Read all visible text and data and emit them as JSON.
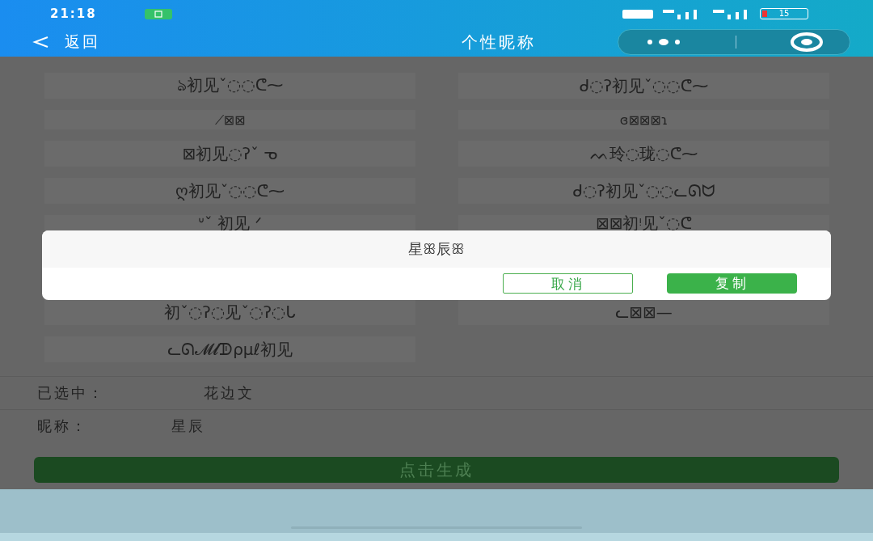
{
  "status_bar": {
    "time": "21:18",
    "battery": "15"
  },
  "nav": {
    "back": "返回",
    "title": "个性昵称"
  },
  "names": [
    {
      "left": "ঌ初见ˇ◌◌ᕦ⁓",
      "right": "ᑯ◌ʔ初见ˇ◌◌ᕦ⁓"
    },
    {
      "left": "⟋⊠⊠",
      "right": "ɞ⊠⊠⊠ɿ"
    },
    {
      "left": "⊠初见◌ʔˇ ᓀ",
      "right": "ᨓ玲◌珑◌ᕦ⁓"
    },
    {
      "left": "ღ初见ˇ◌◌ᕦ⁓",
      "right": "ᑯ◌ʔ初见ˇ◌◌ᓚᘏᗢ"
    },
    {
      "left": "ᐡˇ 初见 ᐟ",
      "right": "⊠⊠初ᵎ见ˇ◌ᕦ"
    },
    {
      "left": "初ˇ◌ʔ◌见ˇ◌ʔ◌ᒐ",
      "right": "ᓚ⊠⊠—"
    },
    {
      "left": "ᓚᘏ𝓜𝓵ᗫρμℓ初见"
    }
  ],
  "selected": {
    "label": "已选中：",
    "value": "花边文"
  },
  "nickname": {
    "label": "昵称：",
    "value": "星辰"
  },
  "generate_button": "点击生成",
  "dialog": {
    "text": "星ꕥ辰ꕥ",
    "cancel": "取消",
    "copy": "复制"
  }
}
